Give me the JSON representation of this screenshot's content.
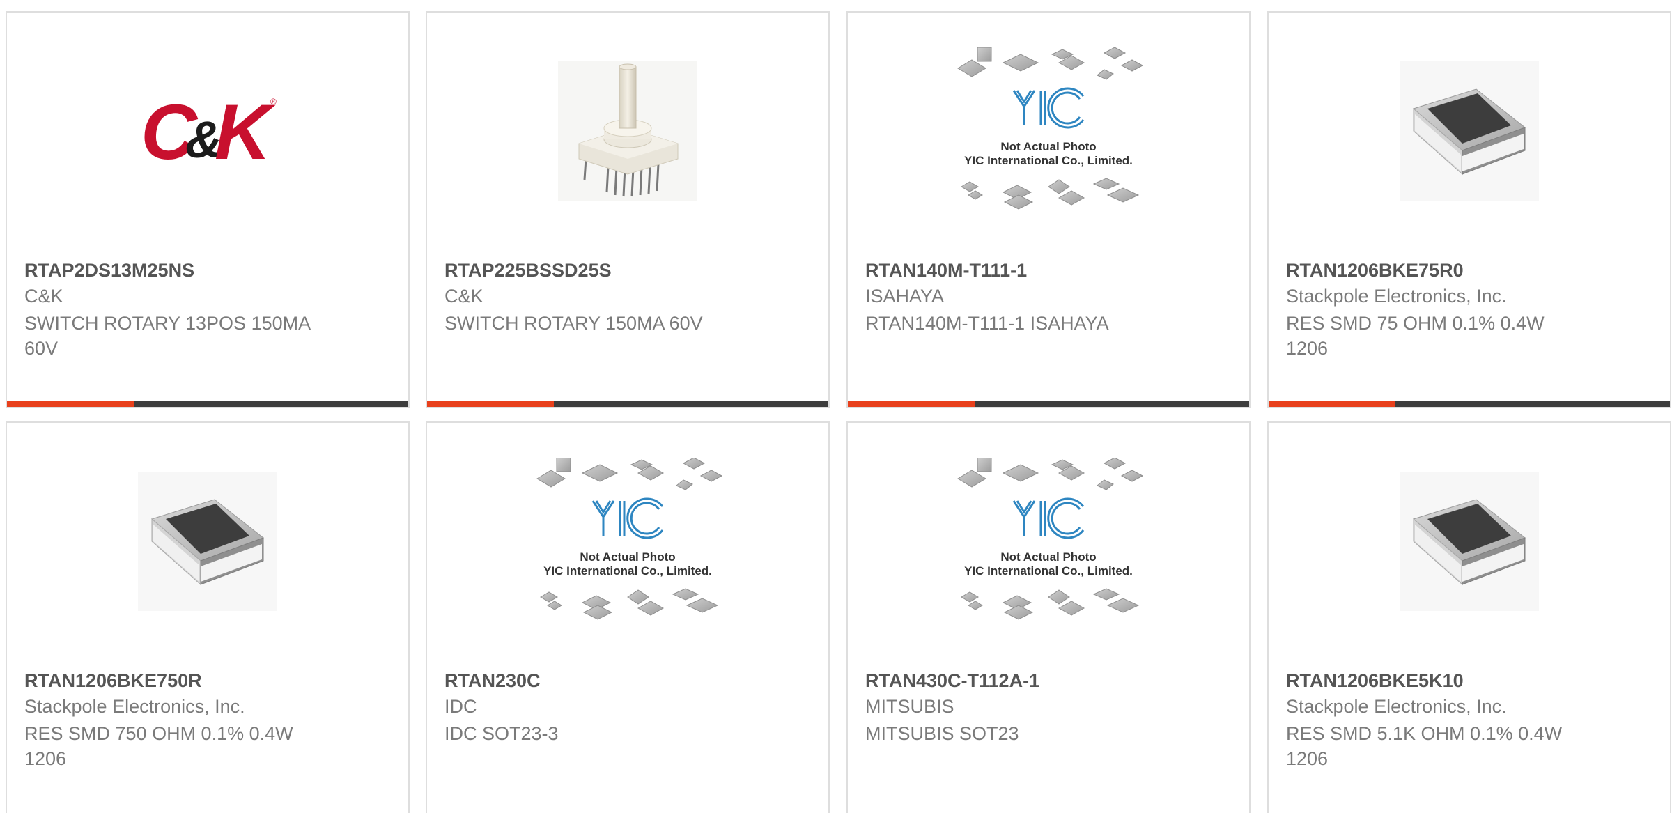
{
  "colors": {
    "accent": "#e8401c",
    "bar_dark": "#3d3d3d",
    "border": "#dedede",
    "title": "#555555",
    "text": "#7a7a7a",
    "ck_red": "#c8102e"
  },
  "logo_ck": {
    "part1": "C",
    "amp": "&",
    "part2": "K",
    "reg": "®"
  },
  "yic_placeholder": {
    "line1": "Not Actual Photo",
    "line2": "YIC International Co., Limited."
  },
  "products": [
    {
      "part_number": "RTAP2DS13M25NS",
      "manufacturer": "C&K",
      "description": "SWITCH ROTARY 13POS 150MA 60V",
      "image": "ck-logo"
    },
    {
      "part_number": "RTAP225BSSD25S",
      "manufacturer": "C&K",
      "description": "SWITCH ROTARY 150MA 60V",
      "image": "rotary-switch-photo"
    },
    {
      "part_number": "RTAN140M-T111-1",
      "manufacturer": "ISAHAYA",
      "description": "RTAN140M-T111-1 ISAHAYA",
      "image": "yic-placeholder"
    },
    {
      "part_number": "RTAN1206BKE75R0",
      "manufacturer": "Stackpole Electronics, Inc.",
      "description": "RES SMD 75 OHM 0.1% 0.4W 1206",
      "image": "smd-resistor-photo"
    },
    {
      "part_number": "RTAN1206BKE750R",
      "manufacturer": "Stackpole Electronics, Inc.",
      "description": "RES SMD 750 OHM 0.1% 0.4W 1206",
      "image": "smd-resistor-photo"
    },
    {
      "part_number": "RTAN230C",
      "manufacturer": "IDC",
      "description": "IDC SOT23-3",
      "image": "yic-placeholder"
    },
    {
      "part_number": "RTAN430C-T112A-1",
      "manufacturer": "MITSUBIS",
      "description": "MITSUBIS SOT23",
      "image": "yic-placeholder"
    },
    {
      "part_number": "RTAN1206BKE5K10",
      "manufacturer": "Stackpole Electronics, Inc.",
      "description": "RES SMD 5.1K OHM 0.1% 0.4W 1206",
      "image": "smd-resistor-photo"
    }
  ]
}
